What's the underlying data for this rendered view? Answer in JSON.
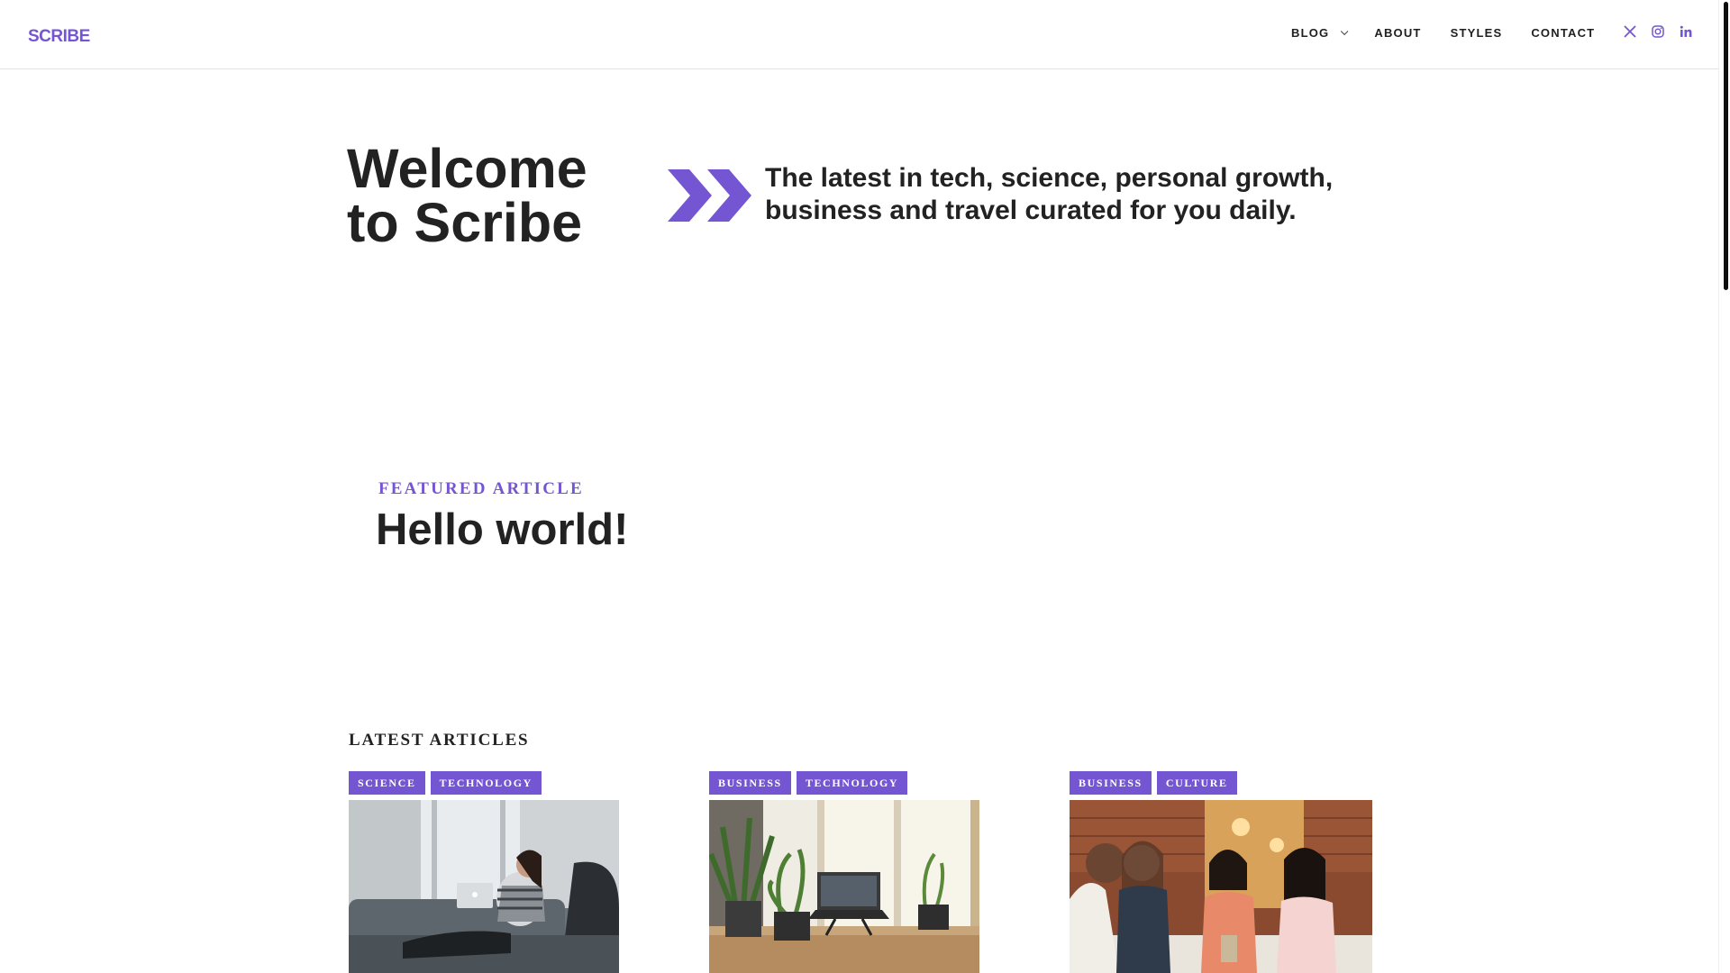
{
  "brand": {
    "logo_text": "SCRIBE",
    "accent_color": "#7556d2"
  },
  "nav": {
    "items": [
      {
        "label": "BLOG",
        "has_dropdown": true
      },
      {
        "label": "ABOUT"
      },
      {
        "label": "STYLES"
      },
      {
        "label": "CONTACT"
      }
    ],
    "socials": [
      "x-icon",
      "instagram-icon",
      "linkedin-icon"
    ]
  },
  "hero": {
    "title_line1": "Welcome",
    "title_line2": "to Scribe",
    "tagline_line1": "The latest in tech, science, personal growth,",
    "tagline_line2": "business and travel curated for you daily."
  },
  "featured": {
    "label": "FEATURED ARTICLE",
    "title": "Hello world!"
  },
  "latest": {
    "heading": "LATEST ARTICLES",
    "cards": [
      {
        "tags": [
          "SCIENCE",
          "TECHNOLOGY"
        ],
        "image": "woman-with-laptop-on-couch-photo"
      },
      {
        "tags": [
          "BUSINESS",
          "TECHNOLOGY"
        ],
        "image": "desk-with-plants-and-laptop-photo"
      },
      {
        "tags": [
          "BUSINESS",
          "CULTURE"
        ],
        "image": "women-talking-in-cafe-photo"
      }
    ]
  }
}
